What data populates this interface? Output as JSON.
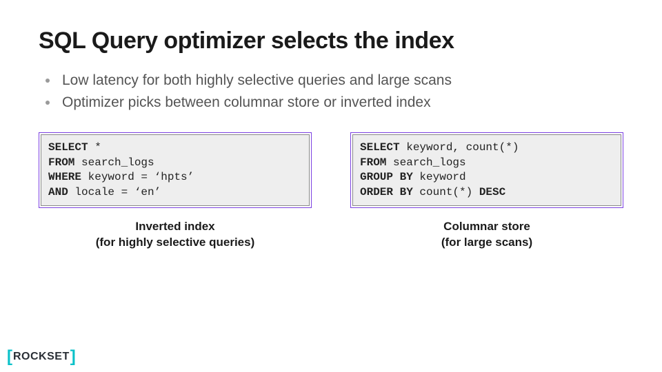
{
  "title": "SQL Query optimizer selects the index",
  "bullets": [
    "Low latency for both highly selective queries and large scans",
    "Optimizer picks between columnar store or inverted index"
  ],
  "examples": {
    "left": {
      "caption_line1": "Inverted index",
      "caption_line2": "(for highly selective queries)",
      "code": {
        "l1_kw": "SELECT",
        "l1_rest": " *",
        "l2_kw": "FROM",
        "l2_rest": " search_logs",
        "l3_kw": "WHERE",
        "l3_rest": " keyword = ‘hpts’",
        "l4_kw": "AND",
        "l4_rest": " locale = ‘en’"
      }
    },
    "right": {
      "caption_line1": "Columnar store",
      "caption_line2": "(for large scans)",
      "code": {
        "l1_kw": "SELECT",
        "l1_rest": " keyword, count(*)",
        "l2_kw": "FROM",
        "l2_rest": " search_logs",
        "l3_kw": "GROUP BY",
        "l3_rest": " keyword",
        "l4_kw": "ORDER BY",
        "l4_mid": " count(*) ",
        "l4_kw2": "DESC"
      }
    }
  },
  "footer": {
    "brand": "ROCKSET",
    "lbracket": "[",
    "rbracket": "]"
  }
}
